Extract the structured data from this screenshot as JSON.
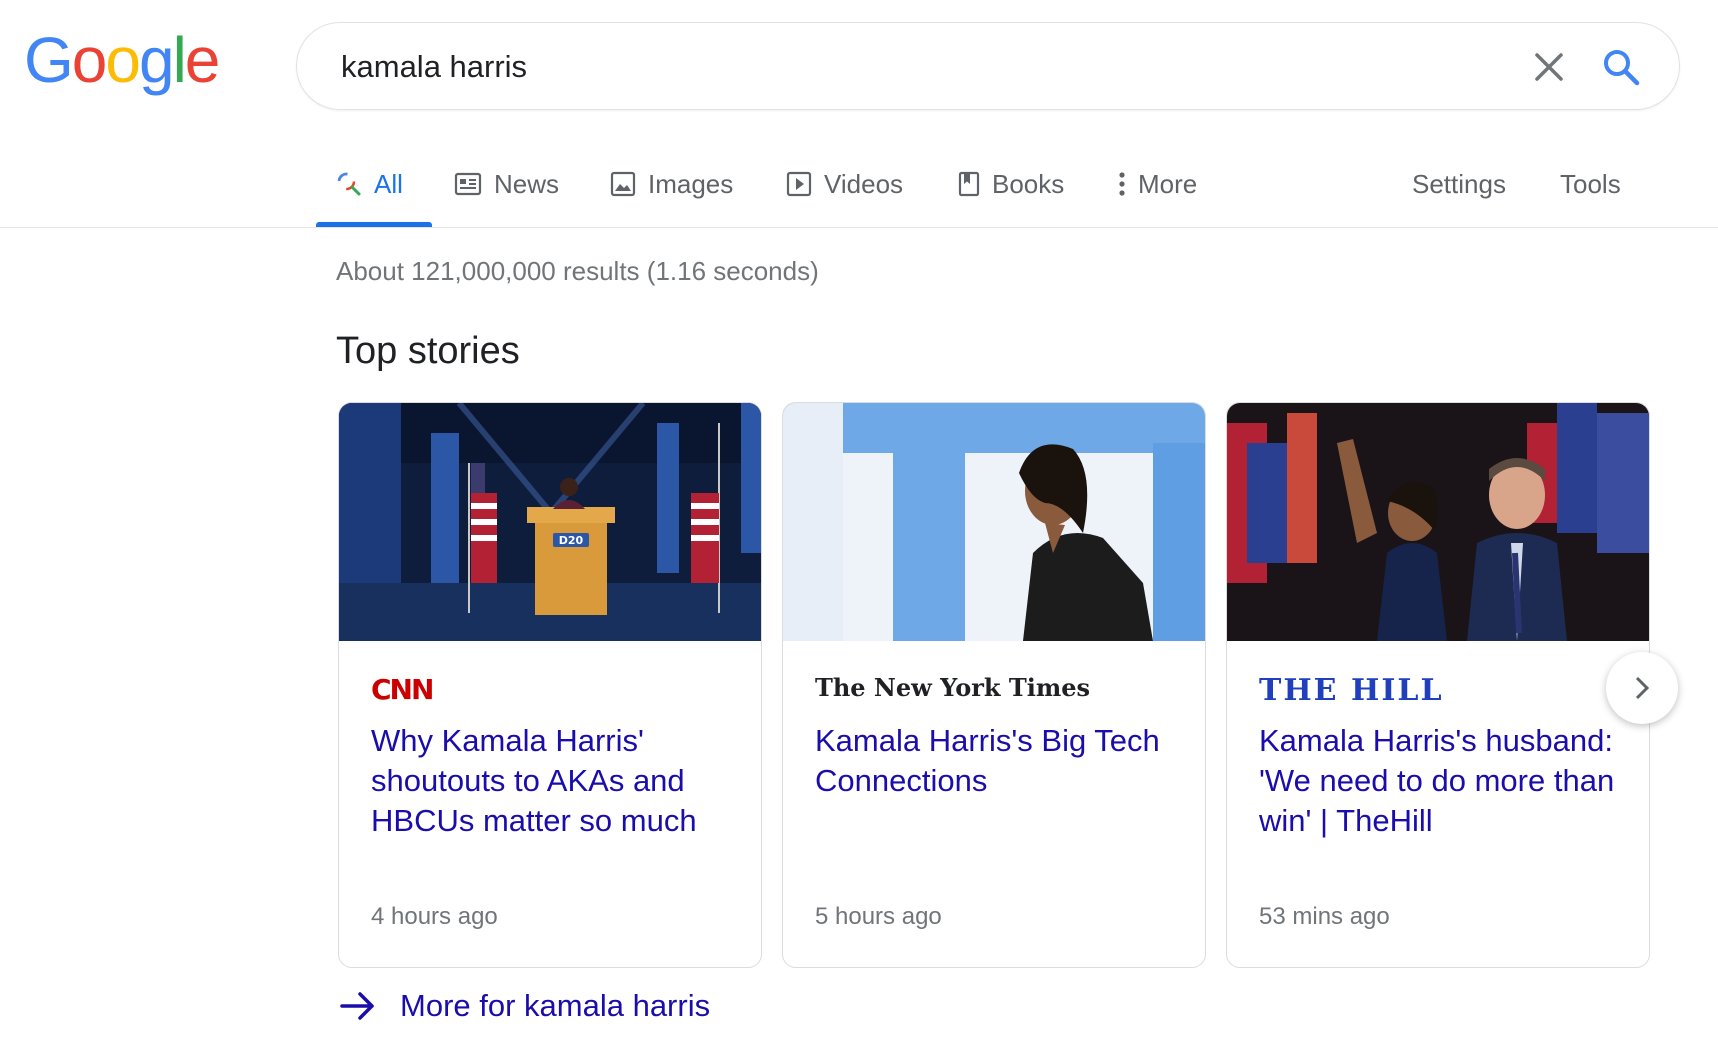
{
  "logo": {
    "letters": [
      "G",
      "o",
      "o",
      "g",
      "l",
      "e"
    ],
    "colors": [
      "#4285F4",
      "#EA4335",
      "#FBBC05",
      "#4285F4",
      "#34A853",
      "#EA4335"
    ]
  },
  "search": {
    "query": "kamala harris",
    "clear_icon": "close-icon",
    "search_icon": "search-icon"
  },
  "tabs": [
    {
      "label": "All",
      "icon": "search-icon",
      "active": true
    },
    {
      "label": "News",
      "icon": "news-icon"
    },
    {
      "label": "Images",
      "icon": "image-icon"
    },
    {
      "label": "Videos",
      "icon": "play-icon"
    },
    {
      "label": "Books",
      "icon": "book-icon"
    },
    {
      "label": "More",
      "icon": "kebab-icon"
    }
  ],
  "tools": {
    "settings": "Settings",
    "tools": "Tools"
  },
  "stats": "About 121,000,000 results (1.16 seconds)",
  "section_title": "Top stories",
  "stories": [
    {
      "source": "CNN",
      "source_color": "#cc0000",
      "headline": "Why Kamala Harris' shoutouts to AKAs and HBCUs matter so much",
      "time": "4 hours ago",
      "thumb_text": "D20"
    },
    {
      "source": "The New York Times",
      "source_color": "#202124",
      "headline": "Kamala Harris's Big Tech Connections",
      "time": "5 hours ago"
    },
    {
      "source": "THE HILL",
      "source_color": "#1f3fbf",
      "headline": "Kamala Harris's husband: 'We need to do more than win' | TheHill",
      "time": "53 mins ago"
    }
  ],
  "more_link": "More for kamala harris",
  "colors": {
    "accent": "#1a73e8",
    "link": "#1a0dab",
    "muted": "#70757a"
  }
}
